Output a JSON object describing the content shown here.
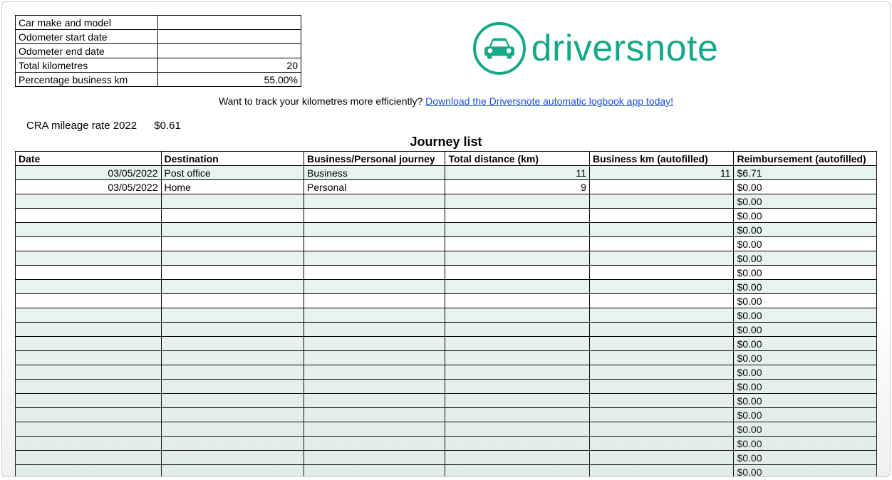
{
  "summary": {
    "rows": [
      {
        "label": "Car make and model",
        "value": ""
      },
      {
        "label": "Odometer start date",
        "value": ""
      },
      {
        "label": "Odometer end date",
        "value": ""
      },
      {
        "label": "Total kilometres",
        "value": "20"
      },
      {
        "label": "Percentage business km",
        "value": "55.00%"
      }
    ]
  },
  "brand": "driversnote",
  "promo": {
    "text": "Want to track your kilometres more efficiently? ",
    "link": "Download the Driversnote automatic logbook app today!"
  },
  "rate": {
    "label": "CRA mileage rate 2022",
    "value": "$0.61"
  },
  "journey_title": "Journey list",
  "journey_headers": [
    "Date",
    "Destination",
    "Business/Personal journey",
    "Total distance (km)",
    "Business km (autofilled)",
    "Reimbursement (autofilled)"
  ],
  "journeys": [
    {
      "date": "03/05/2022",
      "destination": "Post office",
      "type": "Business",
      "distance": "11",
      "business_km": "11",
      "reimbursement": "$6.71",
      "tinted": true
    },
    {
      "date": "03/05/2022",
      "destination": "Home",
      "type": "Personal",
      "distance": "9",
      "business_km": "",
      "reimbursement": "$0.00",
      "tinted": false
    },
    {
      "date": "",
      "destination": "",
      "type": "",
      "distance": "",
      "business_km": "",
      "reimbursement": "$0.00",
      "tinted": true
    },
    {
      "date": "",
      "destination": "",
      "type": "",
      "distance": "",
      "business_km": "",
      "reimbursement": "$0.00",
      "tinted": false
    },
    {
      "date": "",
      "destination": "",
      "type": "",
      "distance": "",
      "business_km": "",
      "reimbursement": "$0.00",
      "tinted": true
    },
    {
      "date": "",
      "destination": "",
      "type": "",
      "distance": "",
      "business_km": "",
      "reimbursement": "$0.00",
      "tinted": false
    },
    {
      "date": "",
      "destination": "",
      "type": "",
      "distance": "",
      "business_km": "",
      "reimbursement": "$0.00",
      "tinted": true
    },
    {
      "date": "",
      "destination": "",
      "type": "",
      "distance": "",
      "business_km": "",
      "reimbursement": "$0.00",
      "tinted": false
    },
    {
      "date": "",
      "destination": "",
      "type": "",
      "distance": "",
      "business_km": "",
      "reimbursement": "$0.00",
      "tinted": true
    },
    {
      "date": "",
      "destination": "",
      "type": "",
      "distance": "",
      "business_km": "",
      "reimbursement": "$0.00",
      "tinted": false
    },
    {
      "date": "",
      "destination": "",
      "type": "",
      "distance": "",
      "business_km": "",
      "reimbursement": "$0.00",
      "tinted": true
    },
    {
      "date": "",
      "destination": "",
      "type": "",
      "distance": "",
      "business_km": "",
      "reimbursement": "$0.00",
      "tinted": true
    },
    {
      "date": "",
      "destination": "",
      "type": "",
      "distance": "",
      "business_km": "",
      "reimbursement": "$0.00",
      "tinted": true
    },
    {
      "date": "",
      "destination": "",
      "type": "",
      "distance": "",
      "business_km": "",
      "reimbursement": "$0.00",
      "tinted": true
    },
    {
      "date": "",
      "destination": "",
      "type": "",
      "distance": "",
      "business_km": "",
      "reimbursement": "$0.00",
      "tinted": true
    },
    {
      "date": "",
      "destination": "",
      "type": "",
      "distance": "",
      "business_km": "",
      "reimbursement": "$0.00",
      "tinted": true
    },
    {
      "date": "",
      "destination": "",
      "type": "",
      "distance": "",
      "business_km": "",
      "reimbursement": "$0.00",
      "tinted": true
    },
    {
      "date": "",
      "destination": "",
      "type": "",
      "distance": "",
      "business_km": "",
      "reimbursement": "$0.00",
      "tinted": true
    },
    {
      "date": "",
      "destination": "",
      "type": "",
      "distance": "",
      "business_km": "",
      "reimbursement": "$0.00",
      "tinted": true
    },
    {
      "date": "",
      "destination": "",
      "type": "",
      "distance": "",
      "business_km": "",
      "reimbursement": "$0.00",
      "tinted": true
    },
    {
      "date": "",
      "destination": "",
      "type": "",
      "distance": "",
      "business_km": "",
      "reimbursement": "$0.00",
      "tinted": true
    },
    {
      "date": "",
      "destination": "",
      "type": "",
      "distance": "",
      "business_km": "",
      "reimbursement": "$0.00",
      "tinted": true
    }
  ]
}
